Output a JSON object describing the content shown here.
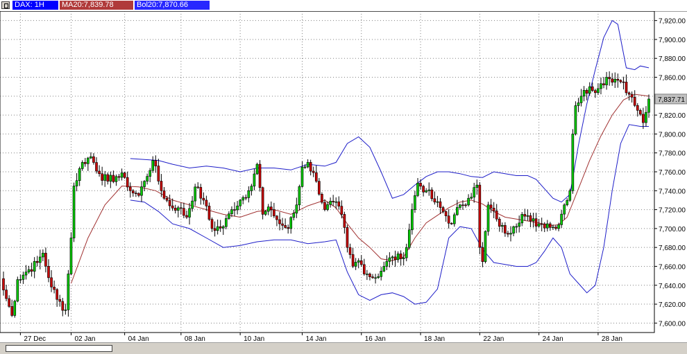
{
  "header": {
    "symbol_label": "DAX: 1H",
    "ma_label": "MA20:7,839.78",
    "bol_label": "Bol20:7,870.66"
  },
  "price_tag": "7,837.71",
  "colors": {
    "up": "#00c800",
    "down": "#c80000",
    "ma": "#a03030",
    "bands": "#1c1cc8",
    "grid": "#808080"
  },
  "chart_data": {
    "type": "candlestick",
    "title": "",
    "xlabel": "",
    "ylabel": "",
    "ylim": [
      7590,
      7930
    ],
    "y_ticks": [
      7600,
      7620,
      7640,
      7660,
      7680,
      7700,
      7720,
      7740,
      7760,
      7780,
      7800,
      7820,
      7840,
      7860,
      7880,
      7900,
      7920
    ],
    "y_tick_labels": [
      "7,600.00",
      "7,620.00",
      "7,640.00",
      "7,660.00",
      "7,680.00",
      "7,700.00",
      "7,720.00",
      "7,740.00",
      "7,760.00",
      "7,780.00",
      "7,800.00",
      "7,820.00",
      "7,840.00",
      "7,860.00",
      "7,880.00",
      "7,900.00",
      "7,920.00"
    ],
    "bar_count": 230,
    "x_ticks": [
      {
        "label": "27 Dec",
        "bar": 6
      },
      {
        "label": "02 Jan",
        "bar": 24
      },
      {
        "label": "04 Jan",
        "bar": 43
      },
      {
        "label": "08 Jan",
        "bar": 63
      },
      {
        "label": "10 Jan",
        "bar": 84
      },
      {
        "label": "14 Jan",
        "bar": 106
      },
      {
        "label": "16 Jan",
        "bar": 127
      },
      {
        "label": "18 Jan",
        "bar": 148
      },
      {
        "label": "22 Jan",
        "bar": 169
      },
      {
        "label": "24 Jan",
        "bar": 190
      },
      {
        "label": "28 Jan",
        "bar": 211
      }
    ],
    "key_points": [
      [
        0,
        7635
      ],
      [
        3,
        7608
      ],
      [
        5,
        7646
      ],
      [
        8,
        7654
      ],
      [
        12,
        7664
      ],
      [
        14,
        7674
      ],
      [
        16,
        7648
      ],
      [
        19,
        7625
      ],
      [
        22,
        7614
      ],
      [
        24,
        7690
      ],
      [
        25,
        7745
      ],
      [
        28,
        7770
      ],
      [
        31,
        7776
      ],
      [
        34,
        7758
      ],
      [
        37,
        7750
      ],
      [
        40,
        7755
      ],
      [
        43,
        7754
      ],
      [
        45,
        7740
      ],
      [
        48,
        7735
      ],
      [
        50,
        7750
      ],
      [
        53,
        7772
      ],
      [
        56,
        7740
      ],
      [
        59,
        7724
      ],
      [
        62,
        7722
      ],
      [
        65,
        7712
      ],
      [
        68,
        7744
      ],
      [
        71,
        7730
      ],
      [
        74,
        7700
      ],
      [
        78,
        7702
      ],
      [
        81,
        7720
      ],
      [
        84,
        7730
      ],
      [
        87,
        7740
      ],
      [
        90,
        7768
      ],
      [
        92,
        7715
      ],
      [
        95,
        7720
      ],
      [
        98,
        7705
      ],
      [
        101,
        7700
      ],
      [
        104,
        7725
      ],
      [
        106,
        7765
      ],
      [
        108,
        7770
      ],
      [
        111,
        7750
      ],
      [
        114,
        7720
      ],
      [
        117,
        7728
      ],
      [
        120,
        7715
      ],
      [
        122,
        7680
      ],
      [
        124,
        7660
      ],
      [
        126,
        7666
      ],
      [
        129,
        7652
      ],
      [
        132,
        7648
      ],
      [
        135,
        7660
      ],
      [
        138,
        7670
      ],
      [
        141,
        7668
      ],
      [
        143,
        7680
      ],
      [
        145,
        7720
      ],
      [
        147,
        7748
      ],
      [
        150,
        7740
      ],
      [
        153,
        7728
      ],
      [
        156,
        7718
      ],
      [
        159,
        7705
      ],
      [
        162,
        7725
      ],
      [
        165,
        7732
      ],
      [
        168,
        7746
      ],
      [
        169,
        7680
      ],
      [
        170,
        7665
      ],
      [
        172,
        7725
      ],
      [
        175,
        7710
      ],
      [
        178,
        7695
      ],
      [
        181,
        7702
      ],
      [
        184,
        7715
      ],
      [
        187,
        7708
      ],
      [
        190,
        7705
      ],
      [
        193,
        7705
      ],
      [
        196,
        7700
      ],
      [
        199,
        7725
      ],
      [
        201,
        7740
      ],
      [
        202,
        7800
      ],
      [
        203,
        7830
      ],
      [
        205,
        7840
      ],
      [
        208,
        7850
      ],
      [
        211,
        7848
      ],
      [
        214,
        7860
      ],
      [
        217,
        7858
      ],
      [
        220,
        7855
      ],
      [
        222,
        7842
      ],
      [
        225,
        7825
      ],
      [
        227,
        7812
      ],
      [
        229,
        7837
      ]
    ],
    "ma20": [
      [
        24,
        7642
      ],
      [
        30,
        7690
      ],
      [
        36,
        7725
      ],
      [
        42,
        7745
      ],
      [
        48,
        7744
      ],
      [
        54,
        7740
      ],
      [
        60,
        7730
      ],
      [
        66,
        7725
      ],
      [
        72,
        7720
      ],
      [
        78,
        7715
      ],
      [
        84,
        7712
      ],
      [
        90,
        7718
      ],
      [
        96,
        7720
      ],
      [
        102,
        7715
      ],
      [
        108,
        7724
      ],
      [
        114,
        7730
      ],
      [
        118,
        7722
      ],
      [
        122,
        7705
      ],
      [
        126,
        7690
      ],
      [
        130,
        7680
      ],
      [
        134,
        7668
      ],
      [
        138,
        7666
      ],
      [
        142,
        7670
      ],
      [
        146,
        7690
      ],
      [
        150,
        7706
      ],
      [
        154,
        7714
      ],
      [
        158,
        7722
      ],
      [
        162,
        7728
      ],
      [
        166,
        7730
      ],
      [
        170,
        7726
      ],
      [
        174,
        7718
      ],
      [
        178,
        7712
      ],
      [
        182,
        7710
      ],
      [
        186,
        7708
      ],
      [
        190,
        7706
      ],
      [
        194,
        7703
      ],
      [
        197,
        7704
      ],
      [
        200,
        7712
      ],
      [
        204,
        7742
      ],
      [
        208,
        7772
      ],
      [
        212,
        7798
      ],
      [
        216,
        7820
      ],
      [
        220,
        7836
      ],
      [
        224,
        7842
      ],
      [
        229,
        7840
      ]
    ],
    "bol_upper": [
      [
        45,
        7774
      ],
      [
        50,
        7773
      ],
      [
        55,
        7772
      ],
      [
        60,
        7768
      ],
      [
        66,
        7764
      ],
      [
        72,
        7766
      ],
      [
        78,
        7764
      ],
      [
        84,
        7760
      ],
      [
        90,
        7764
      ],
      [
        96,
        7764
      ],
      [
        102,
        7762
      ],
      [
        108,
        7768
      ],
      [
        114,
        7766
      ],
      [
        118,
        7770
      ],
      [
        122,
        7790
      ],
      [
        126,
        7797
      ],
      [
        130,
        7786
      ],
      [
        134,
        7760
      ],
      [
        138,
        7732
      ],
      [
        142,
        7736
      ],
      [
        146,
        7746
      ],
      [
        150,
        7755
      ],
      [
        154,
        7760
      ],
      [
        158,
        7760
      ],
      [
        162,
        7758
      ],
      [
        166,
        7755
      ],
      [
        170,
        7754
      ],
      [
        174,
        7760
      ],
      [
        178,
        7758
      ],
      [
        182,
        7756
      ],
      [
        186,
        7756
      ],
      [
        189,
        7752
      ],
      [
        192,
        7742
      ],
      [
        195,
        7732
      ],
      [
        198,
        7728
      ],
      [
        201,
        7736
      ],
      [
        204,
        7788
      ],
      [
        207,
        7832
      ],
      [
        210,
        7868
      ],
      [
        213,
        7902
      ],
      [
        216,
        7920
      ],
      [
        218,
        7916
      ],
      [
        221,
        7870
      ],
      [
        224,
        7868
      ],
      [
        226,
        7872
      ],
      [
        229,
        7870
      ]
    ],
    "bol_lower": [
      [
        45,
        7730
      ],
      [
        50,
        7728
      ],
      [
        55,
        7718
      ],
      [
        60,
        7705
      ],
      [
        66,
        7700
      ],
      [
        72,
        7690
      ],
      [
        78,
        7680
      ],
      [
        84,
        7682
      ],
      [
        90,
        7686
      ],
      [
        96,
        7688
      ],
      [
        102,
        7688
      ],
      [
        108,
        7684
      ],
      [
        114,
        7686
      ],
      [
        118,
        7688
      ],
      [
        122,
        7654
      ],
      [
        126,
        7630
      ],
      [
        130,
        7624
      ],
      [
        134,
        7630
      ],
      [
        138,
        7632
      ],
      [
        142,
        7628
      ],
      [
        146,
        7620
      ],
      [
        150,
        7622
      ],
      [
        154,
        7636
      ],
      [
        158,
        7690
      ],
      [
        162,
        7702
      ],
      [
        166,
        7700
      ],
      [
        170,
        7678
      ],
      [
        174,
        7664
      ],
      [
        178,
        7662
      ],
      [
        182,
        7660
      ],
      [
        186,
        7660
      ],
      [
        189,
        7664
      ],
      [
        192,
        7676
      ],
      [
        195,
        7690
      ],
      [
        198,
        7680
      ],
      [
        201,
        7652
      ],
      [
        204,
        7642
      ],
      [
        207,
        7632
      ],
      [
        210,
        7640
      ],
      [
        213,
        7680
      ],
      [
        216,
        7740
      ],
      [
        219,
        7790
      ],
      [
        222,
        7810
      ],
      [
        226,
        7808
      ],
      [
        229,
        7808
      ]
    ]
  }
}
